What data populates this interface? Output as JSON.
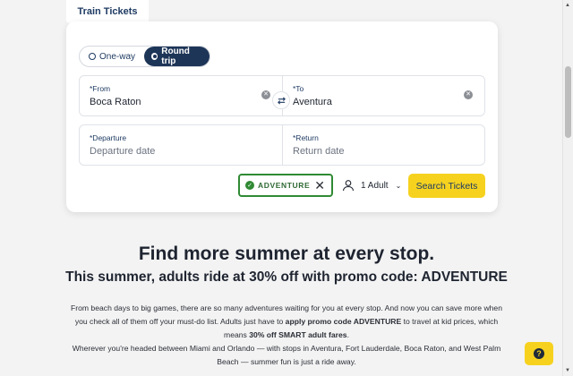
{
  "tab": {
    "label": "Train Tickets"
  },
  "trip_type": {
    "options": [
      "One-way",
      "Round trip"
    ],
    "selected": "Round trip"
  },
  "from": {
    "label": "*From",
    "value": "Boca Raton"
  },
  "to": {
    "label": "*To",
    "value": "Aventura"
  },
  "departure": {
    "label": "*Departure",
    "placeholder": "Departure date"
  },
  "return": {
    "label": "*Return",
    "placeholder": "Return date"
  },
  "promo": {
    "code": "ADVENTURE"
  },
  "passengers": {
    "label": "1 Adult"
  },
  "search": {
    "label": "Search Tickets"
  },
  "headline": "Find more summer at every stop.",
  "subheadline": "This summer, adults ride at 30% off with promo code: ADVENTURE",
  "body": {
    "part1": "From beach days to big games, there are so many adventures waiting for you at every stop. And now you can save more when you check all of them off your must-do list. Adults just have to ",
    "bold1": "apply promo code ADVENTURE",
    "part2": " to travel at kid prices, which means ",
    "bold2": "30% off SMART adult fares",
    "part3": ".",
    "part4": "Wherever you're headed between Miami and Orlando — with stops in Aventura, Fort Lauderdale, Boca Raton, and West Palm Beach — summer fun is just a ride away."
  },
  "colors": {
    "navy": "#1d3557",
    "yellow": "#f6d21f",
    "promo_green": "#2f8a33"
  },
  "icons": {
    "swap": "swap-arrows-icon",
    "clear": "clear-x-icon",
    "person": "person-icon",
    "help": "help-question-icon"
  }
}
